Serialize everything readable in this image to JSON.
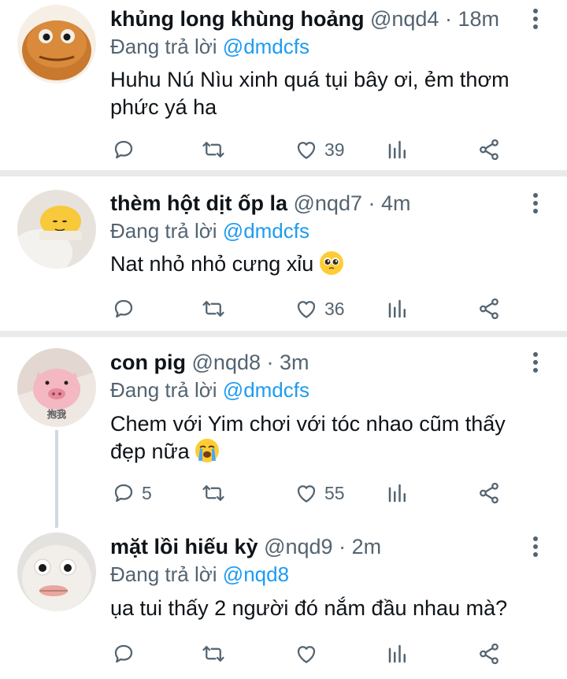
{
  "reply_prefix": "Đang trả lời",
  "tweets": [
    {
      "name": "khủng long khùng hoảng",
      "handle": "@nqd4",
      "time": "18m",
      "reply_to": "@dmdcfs",
      "text": "Huhu Nú Nìu xinh quá tụi bây ơi, ẻm thơm phức yá ha",
      "replies": "",
      "retweets": "",
      "likes": "39"
    },
    {
      "name": "thèm hột dịt ốp la",
      "handle": "@nqd7",
      "time": "4m",
      "reply_to": "@dmdcfs",
      "text": "Nat nhỏ nhỏ cưng xỉu",
      "emoji": "pleading-face",
      "replies": "",
      "retweets": "",
      "likes": "36"
    },
    {
      "name": "con pig",
      "handle": "@nqd8",
      "time": "3m",
      "reply_to": "@dmdcfs",
      "text": "Chem với Yim chơi với tóc nhao cũm thấy đẹp nữa",
      "emoji": "loudly-crying-face",
      "replies": "5",
      "retweets": "",
      "likes": "55",
      "avatar_caption": "抱我"
    },
    {
      "name": "mặt lồi hiếu kỳ",
      "handle": "@nqd9",
      "time": "2m",
      "reply_to": "@nqd8",
      "text": "ụa tui thấy 2 người đó nắm đầu nhau mà?",
      "replies": "",
      "retweets": "",
      "likes": ""
    }
  ],
  "colors": {
    "link": "#1d9bf0",
    "secondary_text": "#536471",
    "primary_text": "#0f1419",
    "divider": "#e9eaeb",
    "thread_line": "#cfd9de"
  }
}
